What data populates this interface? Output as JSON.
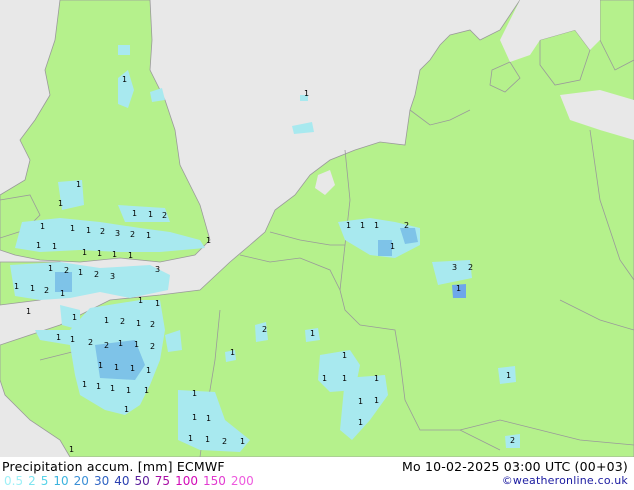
{
  "title": "Precipitation accum. [mm] ECMWF",
  "datetime": "Mo 10-02-2025 03:00 UTC (00+03)",
  "credit": "©weatheronline.co.uk",
  "colors": {
    "sea": "#e8e8e8",
    "land": "#b5f18c",
    "border": "#9a9a9a",
    "light_precip": "#a8e9ef",
    "mid_precip": "#7ec3e8",
    "heavy_precip": "#6ea7ea"
  },
  "legend": [
    {
      "value": "0.5",
      "color": "#9ff0f7"
    },
    {
      "value": "2",
      "color": "#7ee4ef"
    },
    {
      "value": "5",
      "color": "#58d3e8"
    },
    {
      "value": "10",
      "color": "#3cb3de"
    },
    {
      "value": "20",
      "color": "#3a8fd6"
    },
    {
      "value": "30",
      "color": "#2e63c3"
    },
    {
      "value": "40",
      "color": "#2a3fb0"
    },
    {
      "value": "50",
      "color": "#5b1e9c"
    },
    {
      "value": "75",
      "color": "#a80ea4"
    },
    {
      "value": "100",
      "color": "#d20ab7"
    },
    {
      "value": "150",
      "color": "#e23ad0"
    },
    {
      "value": "200",
      "color": "#ee5ade"
    }
  ],
  "map_labels": [
    "1",
    "1",
    "1",
    "1",
    "1",
    "1",
    "2",
    "1",
    "1",
    "1",
    "2",
    "3",
    "2",
    "1",
    "1",
    "1",
    "1",
    "1",
    "1",
    "1",
    "1",
    "1",
    "2",
    "1",
    "2",
    "3",
    "3",
    "1",
    "1",
    "2",
    "1",
    "1",
    "1",
    "1",
    "1",
    "1",
    "2",
    "1",
    "2",
    "1",
    "1",
    "2",
    "2",
    "1",
    "1",
    "2",
    "2",
    "1",
    "1",
    "1",
    "1",
    "1",
    "1",
    "1",
    "1",
    "1",
    "1",
    "1",
    "1",
    "1",
    "1",
    "1",
    "1",
    "1",
    "1",
    "1",
    "1",
    "1",
    "1",
    "1",
    "1",
    "2",
    "1",
    "1",
    "1",
    "1",
    "2",
    "1",
    "3",
    "2",
    "1",
    "1",
    "2",
    "1"
  ]
}
